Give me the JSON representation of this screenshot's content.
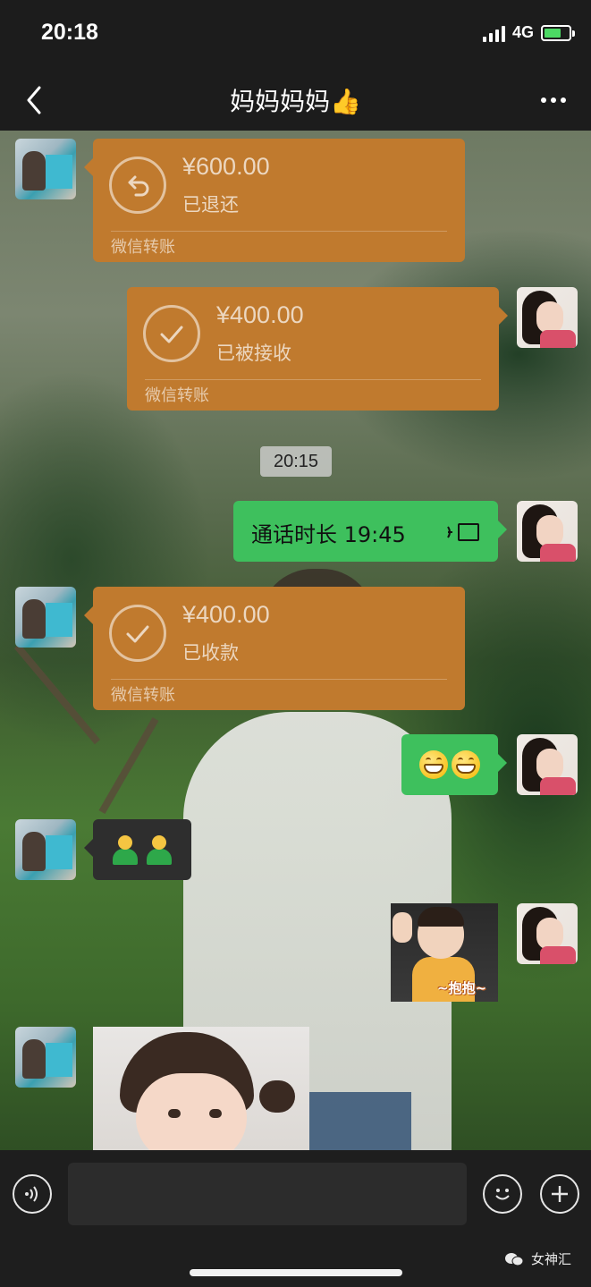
{
  "status_bar": {
    "time": "20:18",
    "network": "4G"
  },
  "nav": {
    "title": "妈妈妈妈👍"
  },
  "messages": {
    "transfer_1": {
      "amount": "¥600.00",
      "status": "已退还",
      "label": "微信转账",
      "side": "left"
    },
    "transfer_2": {
      "amount": "¥400.00",
      "status": "已被接收",
      "label": "微信转账",
      "side": "right"
    },
    "time_divider": "20:15",
    "call": {
      "text": "通话时长 19:45"
    },
    "transfer_3": {
      "amount": "¥400.00",
      "status": "已收款",
      "label": "微信转账",
      "side": "left"
    },
    "grin_emoji_count": 2,
    "person_emoji_count": 2,
    "sticker_caption": "~抱抱~"
  },
  "input_bar": {
    "placeholder": ""
  },
  "watermark": "女神汇",
  "colors": {
    "transfer_card": "#c07a2e",
    "outgoing_bubble": "#3ec05d",
    "incoming_bubble": "#2e2e2e",
    "bar_background": "#1c1c1c"
  },
  "icons": [
    "back-icon",
    "more-icon",
    "refund-icon",
    "check-icon",
    "voice-call-icon",
    "voice-mode-icon",
    "emoji-icon",
    "plus-icon",
    "wechat-logo-icon"
  ]
}
